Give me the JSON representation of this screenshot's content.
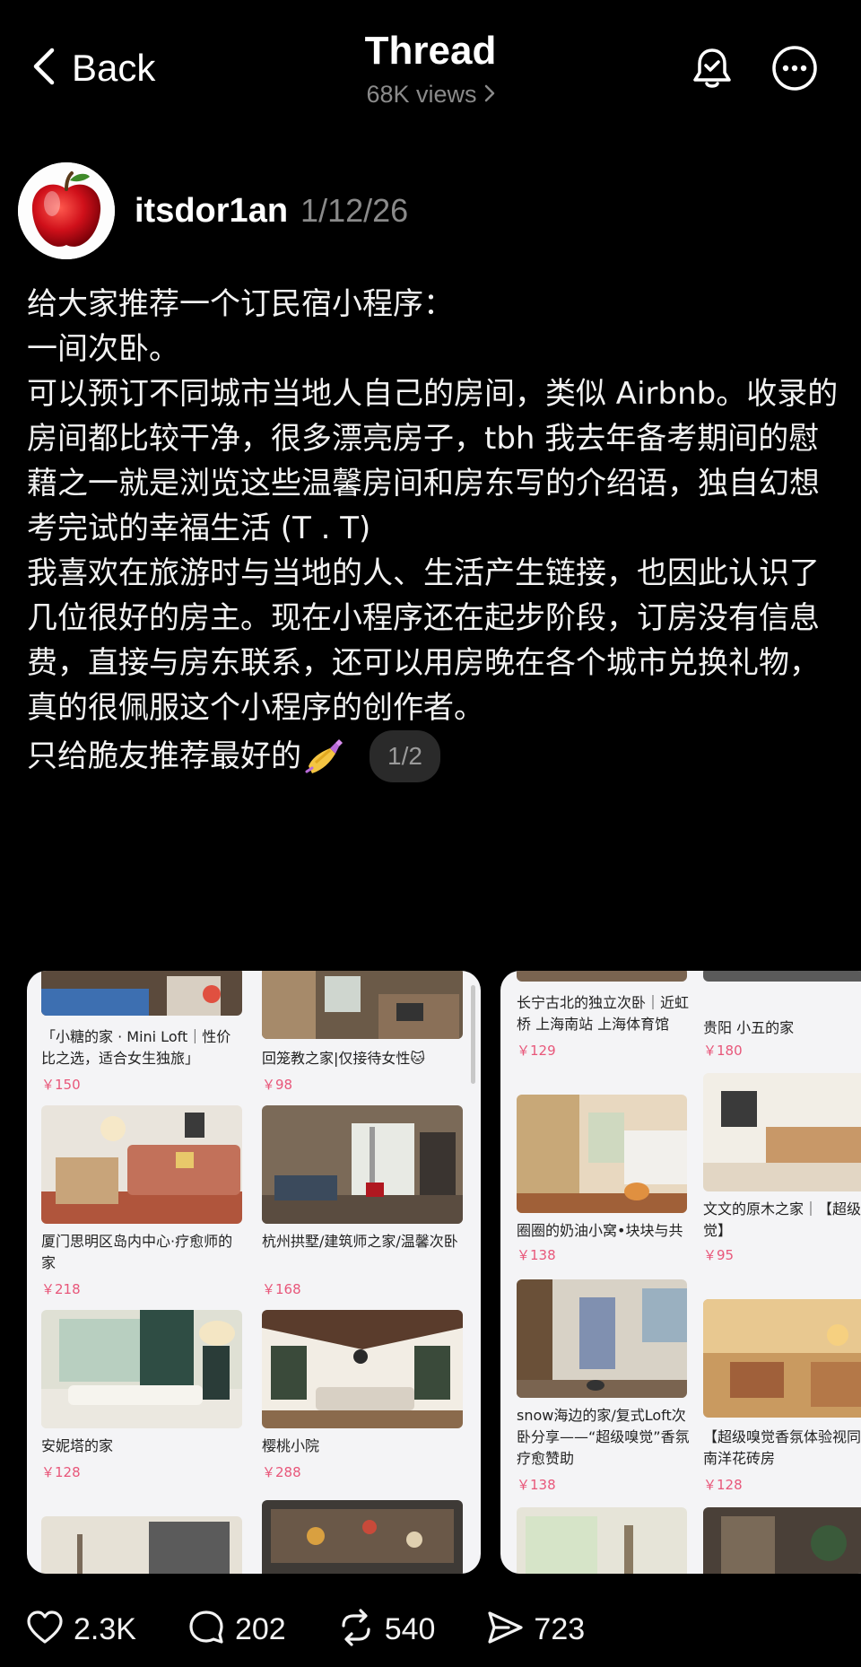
{
  "header": {
    "back_label": "Back",
    "title": "Thread",
    "views": "68K views"
  },
  "author": {
    "username": "itsdor1an",
    "date": "1/12/26"
  },
  "post": {
    "lines": [
      "给大家推荐一个订民宿小程序：",
      "一间次卧。",
      "可以预订不同城市当地人自己的房间，类似 Airbnb。收录的房间都比较干净，很多漂亮房子，tbh 我去年备考期间的慰藉之一就是浏览这些温馨房间和房东写的介绍语，独自幻想考完试的幸福生活 (T . T)",
      "我喜欢在旅游时与当地的人、生活产生链接，也因此认识了几位很好的房主。现在小程序还在起步阶段，订房没有信息费，直接与房东联系，还可以用房晚在各个城市兑换礼物，真的很佩服这个小程序的创作者。"
    ],
    "last_line": "只给脆友推荐最好的",
    "image_counter": "1/2"
  },
  "listings_left": [
    {
      "caption": "「小糖的家 · Mini Loft｜性价比之选，适合女生独旅」",
      "price": "￥150"
    },
    {
      "caption": "回笼教之家|仅接待女性🐱",
      "price": "￥98"
    },
    {
      "caption": "厦门思明区岛内中心·疗愈师的家",
      "price": "￥218"
    },
    {
      "caption": "杭州拱墅/建筑师之家/温馨次卧",
      "price": "￥168"
    },
    {
      "caption": "安妮塔的家",
      "price": "￥128"
    },
    {
      "caption": "樱桃小院",
      "price": "￥288"
    }
  ],
  "listings_right": [
    {
      "caption": "长宁古北的独立次卧｜近虹桥 上海南站 上海体育馆",
      "price": "￥129"
    },
    {
      "caption": "贵阳 小五的家",
      "price": "￥180"
    },
    {
      "caption": "圈圈的奶油小窝•块块与共",
      "price": "￥138"
    },
    {
      "caption": "文文的原木之家｜【超级嗅觉】",
      "price": "￥95"
    },
    {
      "caption": "snow海边的家/复式Loft次卧分享——“超级嗅觉”香氛疗愈赞助",
      "price": "￥138"
    },
    {
      "caption": "【超级嗅觉香氛体验视同款南洋花砖房",
      "price": "￥128"
    }
  ],
  "actions": {
    "likes": "2.3K",
    "comments": "202",
    "reposts": "540",
    "shares": "723"
  },
  "colors": {
    "background": "#000000",
    "muted_text": "#8a8a8a",
    "price_pink": "#e8577a"
  },
  "icons": [
    "chevron-left-icon",
    "chevron-right-icon",
    "bell-check-icon",
    "more-icon",
    "heart-icon",
    "comment-icon",
    "repost-icon",
    "share-icon"
  ]
}
